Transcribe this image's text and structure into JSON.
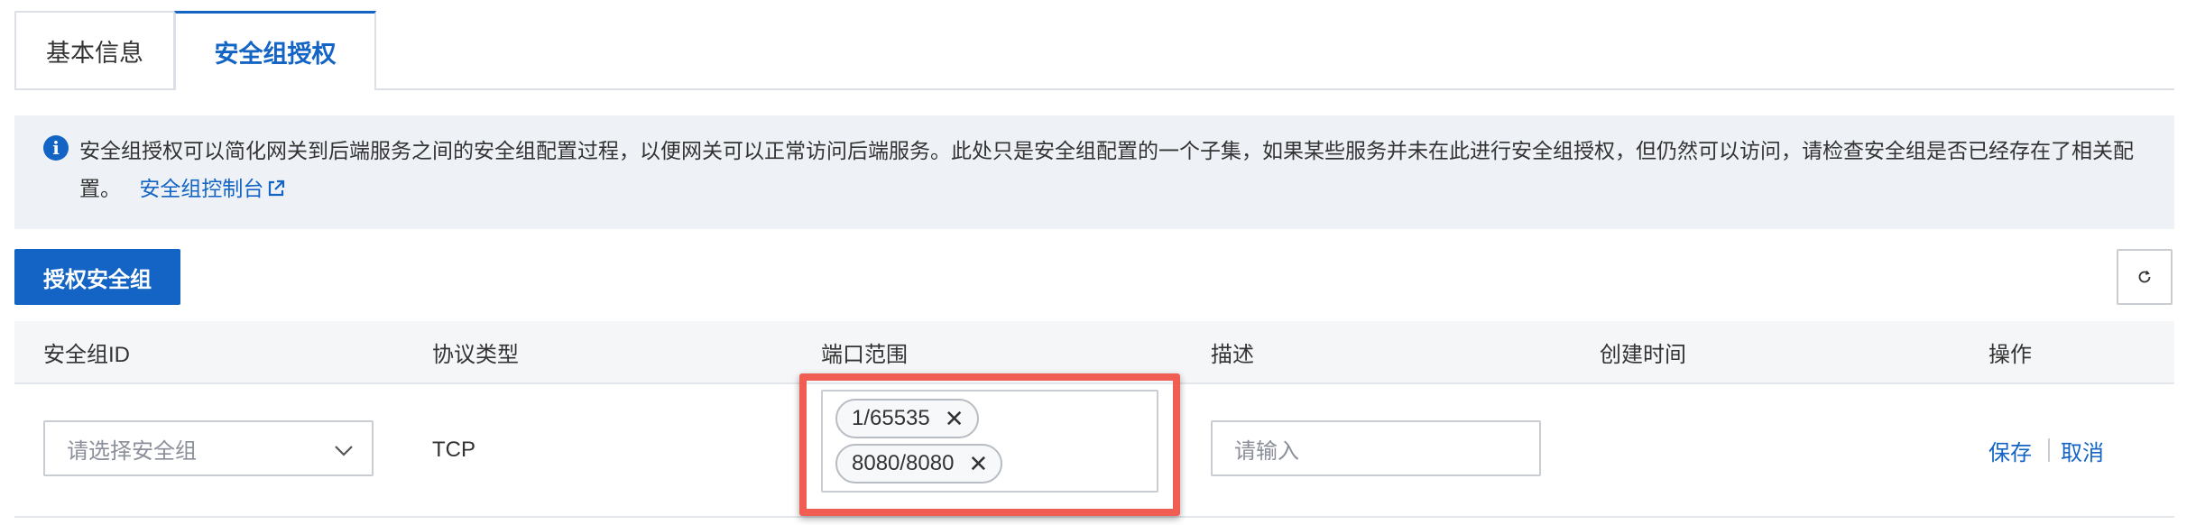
{
  "tabs": [
    {
      "label": "基本信息",
      "active": false
    },
    {
      "label": "安全组授权",
      "active": true
    }
  ],
  "info": {
    "icon": "info-icon",
    "text": "安全组授权可以简化网关到后端服务之间的安全组配置过程，以便网关可以正常访问后端服务。此处只是安全组配置的一个子集，如果某些服务并未在此进行安全组授权，但仍然可以访问，请检查安全组是否已经存在了相关配置。",
    "link_label": "安全组控制台",
    "link_icon": "external-link-icon"
  },
  "toolbar": {
    "authorize_label": "授权安全组",
    "refresh_icon": "refresh-icon"
  },
  "table": {
    "columns": [
      "安全组ID",
      "协议类型",
      "端口范围",
      "描述",
      "创建时间",
      "操作"
    ],
    "row": {
      "group_select_placeholder": "请选择安全组",
      "protocol": "TCP",
      "ports": [
        "1/65535",
        "8080/8080"
      ],
      "description_placeholder": "请输入",
      "created_time": "",
      "save_label": "保存",
      "cancel_label": "取消"
    }
  },
  "colors": {
    "primary": "#1364c4",
    "highlight": "#ef5d53",
    "banner_bg": "#eef2f6",
    "header_bg": "#f5f6f8"
  }
}
